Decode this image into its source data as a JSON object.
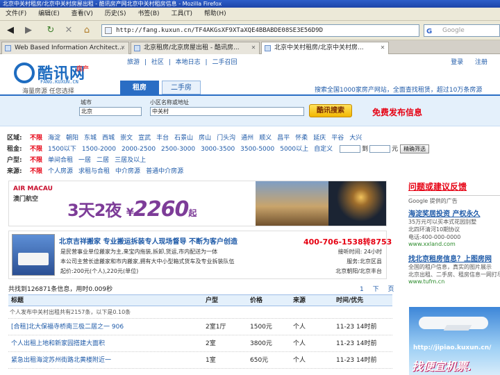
{
  "window": {
    "title": "北京中关村租房/北京中关村房屋出租 - 酷讯房产网北京中关村租房信息 - Mozilla Firefox"
  },
  "menu": [
    "文件(F)",
    "编辑(E)",
    "查看(V)",
    "历史(S)",
    "书签(B)",
    "工具(T)",
    "帮助(H)"
  ],
  "nav": {
    "url": "http://fang.kuxun.cn/TF4AKGsXF9XTaXQE4BBABDE08SE3E56D9D",
    "search_placeholder": "Google"
  },
  "tabs": [
    {
      "label": "Web Based Information Architect...",
      "active": false
    },
    {
      "label": "北京租房/北京房屋出租 - 酷讯房...",
      "active": false
    },
    {
      "label": "北京中关村租房/北京中关村房...",
      "active": true
    }
  ],
  "site": {
    "brand": "酷讯网",
    "brand_sub": "房产",
    "domain": "FANG.KUXUN.CN",
    "slogan": "海量房源 任您选择",
    "top_nav": [
      "旅游",
      "|",
      "社区",
      "|",
      "本地日志",
      "|",
      "二手召回"
    ],
    "top_links": [
      "登录",
      "注册"
    ],
    "search_tabs": [
      "租房",
      "二手房"
    ],
    "tagline": "搜索全国1000家房产网站，全面查找租赁，超过10万条房源",
    "city_label": "城市",
    "city_value": "北京",
    "area_label": "小区名称或地址",
    "area_value": "中关村",
    "search_button": "酷讯搜索",
    "free_post": "免费发布信息"
  },
  "filters": {
    "district": {
      "label": "区域:",
      "options": [
        "不限",
        "海淀",
        "朝阳",
        "东城",
        "西城",
        "崇文",
        "宣武",
        "丰台",
        "石景山",
        "房山",
        "门头沟",
        "通州",
        "顺义",
        "昌平",
        "怀柔",
        "延庆",
        "平谷",
        "大兴"
      ]
    },
    "rent": {
      "label": "租金:",
      "options": [
        "不限",
        "1500以下",
        "1500-2000",
        "2000-2500",
        "2500-3000",
        "3000-3500",
        "3500-5000",
        "5000以上",
        "自定义"
      ],
      "to_label": "到",
      "unit": "元",
      "button": "精确筛选"
    },
    "type": {
      "label": "户型:",
      "options": [
        "不限",
        "单间合租",
        "一居",
        "二居",
        "三居及以上"
      ]
    },
    "source": {
      "label": "来源:",
      "options": [
        "不限",
        "个人房源",
        "求租与合租",
        "中介房源",
        "普通中介房源"
      ]
    }
  },
  "banner": {
    "airline": "AIR MACAU",
    "airline_cn": "澳门航空",
    "deal": "3天2夜",
    "yen": "¥",
    "price": "2260",
    "qi": "起"
  },
  "ad": {
    "title": "北京吉祥搬家 专业搬运拆装专人现场督导 不断为客户创造",
    "phone": "400-706-1538转8753",
    "lines": [
      "是民营事业单位搬家为主,来宝内拖装,拆卸,货运,市内配送为一体",
      "本公司主营长途搬家和市内搬家,拥有大中小型箱式货车及专业拆装队伍",
      "起价:200元(个人),220元(单位)"
    ],
    "right_lines": [
      "接听时间: 24小时",
      "服务:北京区县",
      "北京朝阳/北京丰台"
    ]
  },
  "results": {
    "count_text": "共找到126871条信息，用时0.009秒",
    "pager": [
      "1",
      "下",
      "页"
    ],
    "headers": [
      "标题",
      "户型",
      "价格",
      "来源",
      "时间/优先"
    ],
    "note": "个人发布中关村出租共有2157条，以下是0.10条",
    "rows": [
      {
        "title": "[合租]北大保福寺桥南三极二居之一 906",
        "layout": "2室1厅",
        "price": "1500元",
        "source": "个人",
        "time": "11-23 14时前"
      },
      {
        "title": "个人出租上地和新家园搭建大面积",
        "layout": "2室",
        "price": "3800元",
        "source": "个人",
        "time": "11-23 14时前"
      },
      {
        "title": "紧急出租海淀苏州街路北黄楼附近一",
        "layout": "1室",
        "price": "650元",
        "source": "个人",
        "time": "11-23 14时前"
      }
    ]
  },
  "sidebar": {
    "heading": "问题或建议反馈",
    "google_label": "Google 提供的广告",
    "ads": [
      {
        "title": "海淀奖居投资 产权永久",
        "text": [
          "35万元可以买本式花园别墅",
          "北四环清河10期协议",
          "电话:400-000-0000"
        ],
        "url": "www.xxland.com"
      },
      {
        "title": "找北京租房信息？上图房网",
        "text": [
          "全国的租户信息，真实的图片展示",
          "北京出租、二手房、租房信息一网打尽"
        ],
        "url": "www.tufm.cn"
      }
    ],
    "plane_url": "http://jipiao.kuxun.cn/",
    "plane_cta": "找便宜机票."
  }
}
